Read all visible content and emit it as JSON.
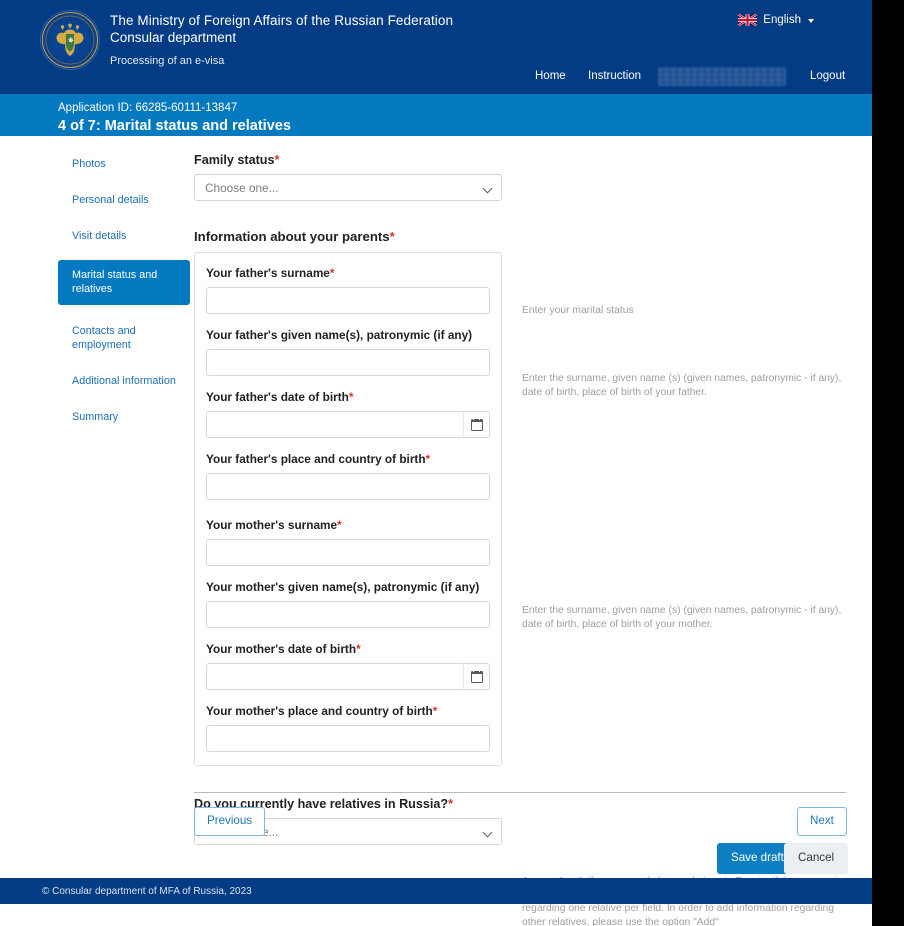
{
  "header": {
    "org_line1": "The Ministry of Foreign Affairs of the Russian Federation",
    "org_line2": "Consular department",
    "subtitle": "Processing of an e-visa",
    "emblem_alt": "russian-coat-of-arms-seal",
    "language": {
      "label": "English",
      "flag": "uk-flag-icon"
    },
    "nav": {
      "home": "Home",
      "instruction": "Instruction",
      "user_redacted": "",
      "logout": "Logout"
    },
    "colors": {
      "header_bg": "#033b84",
      "subheader_bg": "#0579bf",
      "accent": "#0f7fc4",
      "required_star": "#d9352c"
    }
  },
  "subheader": {
    "application_id": "Application ID: 66285-60111-13847",
    "step_title": "4 of 7: Marital status and relatives"
  },
  "sidebar": {
    "items": [
      {
        "label": "Photos",
        "active": false
      },
      {
        "label": "Personal details",
        "active": false
      },
      {
        "label": "Visit details",
        "active": false
      },
      {
        "label": "Marital status and relatives",
        "active": true
      },
      {
        "label": "Contacts and employment",
        "active": false
      },
      {
        "label": "Additional information",
        "active": false
      },
      {
        "label": "Summary",
        "active": false
      }
    ]
  },
  "form": {
    "family_status": {
      "label": "Family status",
      "required": "*",
      "value": "Choose one...",
      "options": [
        "Choose one..."
      ]
    },
    "parents_section": {
      "title": "Information about your parents",
      "required": "*"
    },
    "father": {
      "surname": {
        "label": "Your father's surname",
        "required": "*",
        "value": ""
      },
      "given_names": {
        "label": "Your father's given name(s), patronymic (if any)",
        "required": "",
        "value": ""
      },
      "dob": {
        "label": "Your father's date of birth",
        "required": "*",
        "value": "",
        "icon": "calendar-icon"
      },
      "birthplace": {
        "label": "Your father's place and country of birth",
        "required": "*",
        "value": ""
      }
    },
    "mother": {
      "surname": {
        "label": "Your mother's surname",
        "required": "*",
        "value": ""
      },
      "given_names": {
        "label": "Your mother's given name(s), patronymic (if any)",
        "required": "",
        "value": ""
      },
      "dob": {
        "label": "Your mother's date of birth",
        "required": "*",
        "value": "",
        "icon": "calendar-icon"
      },
      "birthplace": {
        "label": "Your mother's place and country of birth",
        "required": "*",
        "value": ""
      }
    },
    "relatives": {
      "label": "Do you currently have relatives in Russia?",
      "required": "*",
      "value": "Choose one...",
      "options": [
        "Choose one..."
      ]
    }
  },
  "help": {
    "marital": "Enter your marital status",
    "father": "Enter the surname, given name (s) (given names, patronymic - if any), date of birth, place of birth of your father.",
    "mother": "Enter the surname, given name (s) (given names, patronymic - if any), date of birth, place of birth of your mother.",
    "relatives": "Answer \"yes\", if you currently have relatives in Russia. If the answer is yes, you must indicate them. You must only enter the information regarding one relative per field. In order to add information regarding other relatives, please use the option \"Add\""
  },
  "actions": {
    "previous": "Previous",
    "next": "Next",
    "save_draft": "Save draft",
    "cancel": "Cancel"
  },
  "footer": {
    "copyright": "© Consular department of MFA of Russia, 2023"
  }
}
